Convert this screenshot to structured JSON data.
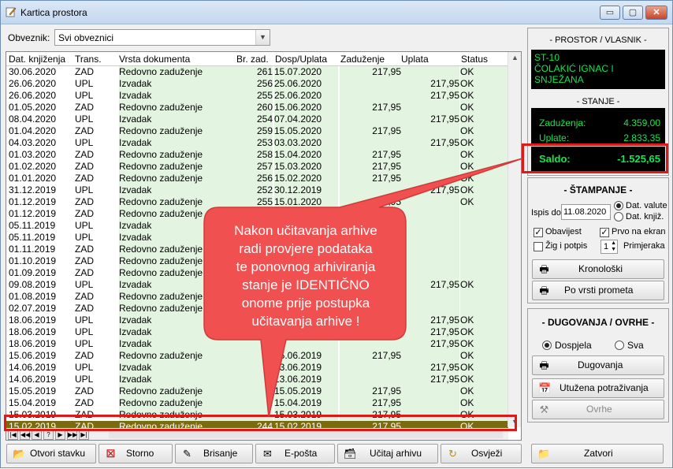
{
  "window": {
    "title": "Kartica prostora",
    "minimize": "▭",
    "maximize": "▢",
    "close": "✕"
  },
  "filter": {
    "label": "Obveznik:",
    "value": "Svi obveznici"
  },
  "grid": {
    "columns": [
      "Dat. knjiženja",
      "Trans.",
      "Vrsta dokumenta",
      "Br. zad.",
      "Dosp/Uplata",
      "Zaduženje",
      "Uplata",
      "Status"
    ],
    "rows": [
      [
        "30.06.2020",
        "ZAD",
        "Redovno zaduženje",
        "261",
        "15.07.2020",
        "217,95",
        "",
        "OK"
      ],
      [
        "26.06.2020",
        "UPL",
        "Izvadak",
        "256",
        "25.06.2020",
        "",
        "217,95",
        "OK"
      ],
      [
        "26.06.2020",
        "UPL",
        "Izvadak",
        "255",
        "25.06.2020",
        "",
        "217,95",
        "OK"
      ],
      [
        "01.05.2020",
        "ZAD",
        "Redovno zaduženje",
        "260",
        "15.06.2020",
        "217,95",
        "",
        "OK"
      ],
      [
        "08.04.2020",
        "UPL",
        "Izvadak",
        "254",
        "07.04.2020",
        "",
        "217,95",
        "OK"
      ],
      [
        "01.04.2020",
        "ZAD",
        "Redovno zaduženje",
        "259",
        "15.05.2020",
        "217,95",
        "",
        "OK"
      ],
      [
        "04.03.2020",
        "UPL",
        "Izvadak",
        "253",
        "03.03.2020",
        "",
        "217,95",
        "OK"
      ],
      [
        "01.03.2020",
        "ZAD",
        "Redovno zaduženje",
        "258",
        "15.04.2020",
        "217,95",
        "",
        "OK"
      ],
      [
        "01.02.2020",
        "ZAD",
        "Redovno zaduženje",
        "257",
        "15.03.2020",
        "217,95",
        "",
        "OK"
      ],
      [
        "01.01.2020",
        "ZAD",
        "Redovno zaduženje",
        "256",
        "15.02.2020",
        "217,95",
        "",
        "OK"
      ],
      [
        "31.12.2019",
        "UPL",
        "Izvadak",
        "252",
        "30.12.2019",
        "",
        "217,95",
        "OK"
      ],
      [
        "01.12.2019",
        "ZAD",
        "Redovno zaduženje",
        "255",
        "15.01.2020",
        "217,95",
        "",
        "OK"
      ],
      [
        "01.12.2019",
        "ZAD",
        "Redovno zaduženje",
        "",
        "",
        "",
        "",
        ""
      ],
      [
        "05.11.2019",
        "UPL",
        "Izvadak",
        "",
        "",
        "",
        "",
        ""
      ],
      [
        "05.11.2019",
        "UPL",
        "Izvadak",
        "",
        "",
        "",
        "",
        ""
      ],
      [
        "01.11.2019",
        "ZAD",
        "Redovno zaduženje",
        "",
        "",
        "",
        "",
        ""
      ],
      [
        "01.10.2019",
        "ZAD",
        "Redovno zaduženje",
        "",
        "",
        "",
        "",
        ""
      ],
      [
        "01.09.2019",
        "ZAD",
        "Redovno zaduženje",
        "",
        "",
        "",
        "",
        ""
      ],
      [
        "09.08.2019",
        "UPL",
        "Izvadak",
        "",
        "",
        "",
        "217,95",
        "OK"
      ],
      [
        "01.08.2019",
        "ZAD",
        "Redovno zaduženje",
        "",
        "",
        "",
        "",
        ""
      ],
      [
        "02.07.2019",
        "ZAD",
        "Redovno zaduženje",
        "",
        "",
        "",
        "",
        ""
      ],
      [
        "18.06.2019",
        "UPL",
        "Izvadak",
        "",
        "",
        "",
        "217,95",
        "OK"
      ],
      [
        "18.06.2019",
        "UPL",
        "Izvadak",
        "",
        "",
        "",
        "217,95",
        "OK"
      ],
      [
        "18.06.2019",
        "UPL",
        "Izvadak",
        "",
        "",
        "",
        "217,95",
        "OK"
      ],
      [
        "15.06.2019",
        "ZAD",
        "Redovno zaduženje",
        "",
        "15.06.2019",
        "217,95",
        "",
        "OK"
      ],
      [
        "14.06.2019",
        "UPL",
        "Izvadak",
        "",
        "13.06.2019",
        "",
        "217,95",
        "OK"
      ],
      [
        "14.06.2019",
        "UPL",
        "Izvadak",
        "",
        "13.06.2019",
        "",
        "217,95",
        "OK"
      ],
      [
        "15.05.2019",
        "ZAD",
        "Redovno zaduženje",
        "",
        "15.05.2019",
        "217,95",
        "",
        "OK"
      ],
      [
        "15.04.2019",
        "ZAD",
        "Redovno zaduženje",
        "",
        "15.04.2019",
        "217,95",
        "",
        "OK"
      ],
      [
        "15.03.2019",
        "ZAD",
        "Redovno zaduženje",
        "",
        "15.03.2019",
        "217,95",
        "",
        "OK"
      ],
      [
        "15.02.2019",
        "ZAD",
        "Redovno zaduženje",
        "244",
        "15.02.2019",
        "217,95",
        "",
        "OK"
      ]
    ],
    "nav": [
      "|◀",
      "◀◀",
      "◀",
      "?",
      "▶",
      "▶▶",
      "▶|"
    ]
  },
  "buttons": {
    "open": "Otvori stavku",
    "storno": "Storno",
    "delete": "Brisanje",
    "email": "E-pošta",
    "load": "Učitaj arhivu",
    "refresh": "Osvježi",
    "close": "Zatvori"
  },
  "property": {
    "title": "- PROSTOR / VLASNIK -",
    "line1": "ST-10",
    "line2": "ČOLAKIĆ IGNAC I",
    "line3": "SNJEŽANA",
    "state_title": "- STANJE -",
    "debt_label": "Zaduženja:",
    "debt_value": "4.359,00",
    "paid_label": "Uplate:",
    "paid_value": "2.833,35",
    "saldo_label": "Saldo:",
    "saldo_value": "-1.525,65"
  },
  "print": {
    "title": "- ŠTAMPANJE -",
    "date_label": "Ispis do:",
    "date_value": "11.08.2020",
    "radio1": "Dat. valute",
    "radio2": "Dat. knjiž.",
    "chk1": "Obavijest",
    "chk2": "Prvo na ekran",
    "chk3": "Žig i potpis",
    "copies_value": "1",
    "copies_label": "Primjeraka",
    "btn1": "Kronološki",
    "btn2": "Po vrsti prometa"
  },
  "debts": {
    "title": "- DUGOVANJA / OVRHE -",
    "radio1": "Dospjela",
    "radio2": "Sva",
    "btn1": "Dugovanja",
    "btn2": "Utužena potraživanja",
    "btn3": "Ovrhe"
  },
  "callout": {
    "lines": [
      "Nakon učitavanja arhive",
      "radi provjere podataka",
      "te ponovnog arhiviranja",
      "stanje je IDENTIČNO",
      "onome prije postupka",
      "učitavanja arhive !"
    ],
    "color": "#f05050"
  }
}
